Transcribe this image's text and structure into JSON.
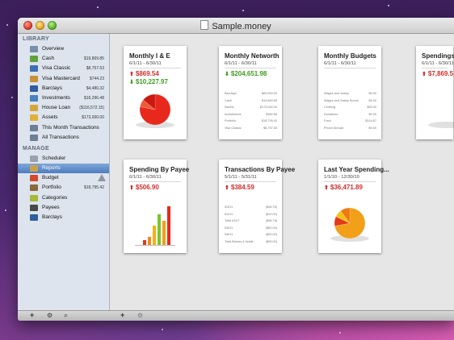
{
  "window": {
    "title": "Sample.money"
  },
  "sidebar": {
    "library_header": "LIBRARY",
    "library_items": [
      {
        "label": "Overview",
        "amount": "",
        "icon": "overview-icon",
        "color": "#7a8fa8"
      },
      {
        "label": "Cash",
        "amount": "$19,869.85",
        "icon": "cash-icon",
        "color": "#5fa33a"
      },
      {
        "label": "Visa Classic",
        "amount": "$8,757.53",
        "icon": "credit-card-icon",
        "color": "#3f6fb5"
      },
      {
        "label": "Visa Mastercard",
        "amount": "$744.23",
        "icon": "credit-card-icon",
        "color": "#c8913a"
      },
      {
        "label": "Barclays",
        "amount": "$4,480.32",
        "icon": "bank-icon",
        "color": "#2f5e9e"
      },
      {
        "label": "Investments",
        "amount": "$16,296.48",
        "icon": "investments-icon",
        "color": "#4a7fc1"
      },
      {
        "label": "House Loan",
        "amount": "($116,572.15)",
        "icon": "house-icon",
        "color": "#d4a63a"
      },
      {
        "label": "Assets",
        "amount": "$173,000.00",
        "icon": "assets-icon",
        "color": "#e0b23a"
      },
      {
        "label": "This Month Transactions",
        "amount": "",
        "icon": "smart-folder-icon",
        "color": "#6d7f96"
      },
      {
        "label": "All Transactions",
        "amount": "",
        "icon": "smart-folder-icon",
        "color": "#6d7f96"
      }
    ],
    "manage_header": "MANAGE",
    "manage_items": [
      {
        "label": "Scheduler",
        "amount": "",
        "icon": "clock-icon",
        "color": "#9aa3ad"
      },
      {
        "label": "Reports",
        "amount": "",
        "icon": "reports-icon",
        "color": "#c9a24a",
        "selected": true
      },
      {
        "label": "Budget",
        "amount": "",
        "icon": "budget-icon",
        "color": "#d44a2a"
      },
      {
        "label": "Portfolio",
        "amount": "$18,795.42",
        "icon": "portfolio-icon",
        "color": "#8a6a3a"
      },
      {
        "label": "Categories",
        "amount": "",
        "icon": "categories-icon",
        "color": "#a8b83a"
      },
      {
        "label": "Payees",
        "amount": "",
        "icon": "person-icon",
        "color": "#4a4a4a"
      },
      {
        "label": "Barclays",
        "amount": "",
        "icon": "bank-icon",
        "color": "#2f5e9e"
      }
    ]
  },
  "reports": [
    {
      "title": "Monthly I & E",
      "date": "6/1/11 - 6/30/11",
      "amount1": "$869.54",
      "amount1_dir": "up",
      "amount2": "$10,227.97",
      "amount2_dir": "down",
      "graphic": "pie"
    },
    {
      "title": "Monthly Networth",
      "date": "6/1/11 - 6/30/11",
      "amount1": "$204,651.98",
      "amount1_dir": "down",
      "amount2": "",
      "graphic": "rows",
      "rows": [
        [
          "Barclays",
          "$60,000.00"
        ],
        [
          "Cash",
          "$19,869.85"
        ],
        [
          "Assets",
          "$173,000.00"
        ],
        [
          "Investments",
          "$360.56"
        ],
        [
          "Portfolio",
          "$18,795.42"
        ],
        [
          "Visa Classic",
          "$8,757.53"
        ]
      ]
    },
    {
      "title": "Monthly Budgets",
      "date": "6/1/11 - 6/30/11",
      "amount1": "",
      "amount2": "",
      "graphic": "rows",
      "rows": [
        [
          "Wages and Salary",
          "$0.00"
        ],
        [
          "Wages and Salary Bonus",
          "$0.00"
        ],
        [
          "Clothing",
          "$90.00"
        ],
        [
          "Donations",
          "$0.00"
        ],
        [
          "Food",
          "$144.67"
        ],
        [
          "Phone Abroad",
          "$0.00"
        ]
      ]
    },
    {
      "title": "Spendings",
      "date": "6/1/11 - 6/30/11",
      "amount1": "$7,869.5",
      "amount1_dir": "up",
      "amount2": "",
      "graphic": "pie-green"
    },
    {
      "title": "Spending By Payee",
      "date": "6/1/11 - 6/30/11",
      "amount1": "$506.90",
      "amount1_dir": "up",
      "amount2": "",
      "graphic": "bars"
    },
    {
      "title": "Transactions By Payee",
      "date": "5/1/11 - 5/31/11",
      "amount1": "$384.59",
      "amount1_dir": "up",
      "amount2": "",
      "graphic": "rows",
      "rows": [
        [
          "5/3/11",
          "($46.78)"
        ],
        [
          "5/4/11",
          "($10.00)"
        ],
        [
          "Total AT&T",
          "($56.78)"
        ],
        [
          "5/5/11",
          "($50.00)"
        ],
        [
          "5/8/11",
          "($99.00)"
        ],
        [
          "Total Barnes & Noble",
          "($99.00)"
        ]
      ]
    },
    {
      "title": "Last Year Spending...",
      "date": "1/1/10 - 12/30/10",
      "amount1": "$36,471.89",
      "amount1_dir": "up",
      "amount2": "",
      "graphic": "pie-orange"
    }
  ],
  "bottombar": {
    "add_icon": "+",
    "gear_icon": "⚙",
    "search_icon": "⌕"
  }
}
